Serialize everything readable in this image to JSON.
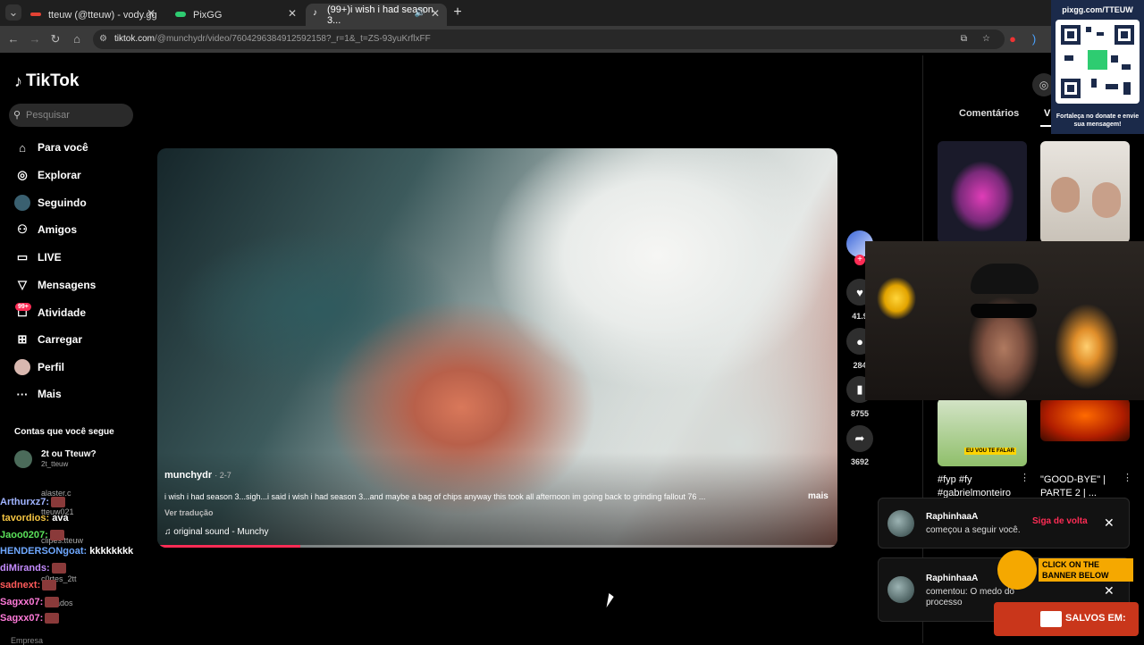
{
  "browser": {
    "tabs": [
      {
        "title": "tteuw (@tteuw) - vody.gg",
        "color": "#e34234"
      },
      {
        "title": "PixGG",
        "color": "#2ecc71"
      },
      {
        "title": "(99+)i wish i had season 3...",
        "color": "#ffffff"
      }
    ],
    "url_main": "tiktok.com",
    "url_rest": "/@munchydr/video/7604296384912592158?_r=1&_t=ZS-93yuKrflxFF"
  },
  "tiktok": {
    "logo": "TikTok",
    "search_placeholder": "Pesquisar",
    "nav": [
      {
        "label": "Para você",
        "icon": "home-icon"
      },
      {
        "label": "Explorar",
        "icon": "compass-icon"
      },
      {
        "label": "Seguindo",
        "icon": "following-icon"
      },
      {
        "label": "Amigos",
        "icon": "friends-icon"
      },
      {
        "label": "LIVE",
        "icon": "live-icon"
      },
      {
        "label": "Mensagens",
        "icon": "messages-icon"
      },
      {
        "label": "Atividade",
        "icon": "activity-icon"
      },
      {
        "label": "Carregar",
        "icon": "upload-icon"
      },
      {
        "label": "Perfil",
        "icon": "profile-icon"
      },
      {
        "label": "Mais",
        "icon": "more-icon"
      }
    ],
    "activity_badge": "99+",
    "following_heading": "Contas que você segue",
    "following_account": {
      "name": "2t ou Tteuw?",
      "handle": "2t_tteuw"
    },
    "footer_text": "Empresa"
  },
  "chat_overlay": [
    {
      "user": "Arthurxz7:",
      "color": "#a0b4ff",
      "message": ""
    },
    {
      "user": "tavordios:",
      "color": "#f5c542",
      "message": "ava"
    },
    {
      "user": "Jaoo0207:",
      "color": "#5be35b",
      "message": ""
    },
    {
      "user": "HENDERSONgoat:",
      "color": "#6fa8ff",
      "message": "kkkkkkkk"
    },
    {
      "user": "diMirands:",
      "color": "#c58cff",
      "message": ""
    },
    {
      "user": "sadnext:",
      "color": "#ff5a5a",
      "message": ""
    },
    {
      "user": "Sagxx07:",
      "color": "#ff7ad9",
      "message": ""
    },
    {
      "user": "Sagxx07:",
      "color": "#ff7ad9",
      "message": ""
    }
  ],
  "chat_background_text": [
    "alaster.c",
    "tteuw021",
    "clipes.tteuw",
    "c0rtes_2tt",
    "ados"
  ],
  "video": {
    "author": "munchydr",
    "date": "· 2-7",
    "caption": "i wish i had season 3...sigh...i said i wish i had season 3...and maybe a bag of chips anyway this took all afternoon im going back to grinding fallout 76 ...",
    "more_label": "mais",
    "translate_label": "Ver tradução",
    "sound": "original sound - Munchy",
    "progress": 0.21
  },
  "actions": {
    "likes": "41.9",
    "comments": "284",
    "saves": "8755",
    "shares": "3692"
  },
  "right_panel": {
    "tab_comments": "Comentários",
    "tab_videos": "V",
    "captions": [
      {
        "text": "#fyp #fy #gabrielmonteiro"
      },
      {
        "text": "\"GOOD-BYE\" | PARTE 2 | ..."
      }
    ],
    "thumb_tag": "EU VOU TE FALAR"
  },
  "pix": {
    "title": "pixgg.com/TTEUW",
    "subtitle": "Fortaleça no donate e envie sua mensagem!"
  },
  "notifications": [
    {
      "name": "RaphinhaaA",
      "text": "começou a seguir você.",
      "action": "Siga de volta"
    },
    {
      "name": "RaphinhaaA",
      "text": "comentou: O medo do processo",
      "action": ""
    }
  ],
  "banners": {
    "click": "CLICK ON THE BANNER BELOW",
    "saved": "SALVOS EM:"
  }
}
